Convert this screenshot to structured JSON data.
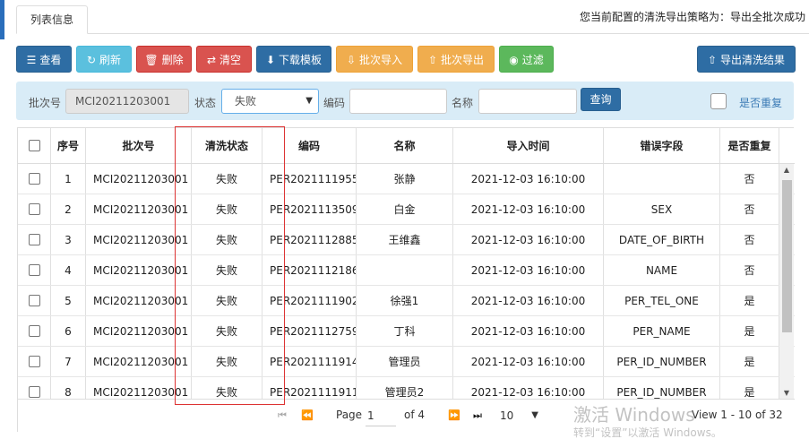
{
  "tab": {
    "label": "列表信息"
  },
  "policy": {
    "text": "您当前配置的清洗导出策略为：导出全批次成功"
  },
  "toolbar": {
    "buttons": [
      {
        "icon": "list-icon",
        "glyph": "☰",
        "label": "查看"
      },
      {
        "icon": "refresh-icon",
        "glyph": "↻",
        "label": "刷新"
      },
      {
        "icon": "trash-icon",
        "glyph": "🗑",
        "label": "删除"
      },
      {
        "icon": "swap-icon",
        "glyph": "⇄",
        "label": "清空"
      },
      {
        "icon": "download-icon",
        "glyph": "⬇",
        "label": "下载模板"
      },
      {
        "icon": "import-icon",
        "glyph": "⇩",
        "label": "批次导入"
      },
      {
        "icon": "export-icon",
        "glyph": "⇧",
        "label": "批次导出"
      },
      {
        "icon": "eye-icon",
        "glyph": "◉",
        "label": "过滤"
      },
      {
        "icon": "export-clean-icon",
        "glyph": "⇧",
        "label": "导出清洗结果"
      }
    ]
  },
  "filter": {
    "batch_label": "批次号",
    "batch_value": "MCI20211203001",
    "status_label": "状态",
    "status_value": "失败",
    "code_label": "编码",
    "code_value": "",
    "name_label": "名称",
    "name_value": "",
    "query_label": "查询",
    "duplicate_label": "是否重复"
  },
  "table": {
    "columns": [
      "序号",
      "批次号",
      "清洗状态",
      "编码",
      "名称",
      "导入时间",
      "错误字段",
      "是否重复"
    ],
    "rows": [
      [
        "1",
        "MCI20211203001",
        "失败",
        "PER2021111955",
        "张静",
        "2021-12-03 16:10:00",
        "",
        "否"
      ],
      [
        "2",
        "MCI20211203001",
        "失败",
        "PER2021113509",
        "白金",
        "2021-12-03 16:10:00",
        "SEX",
        "否"
      ],
      [
        "3",
        "MCI20211203001",
        "失败",
        "PER2021112885",
        "王维鑫",
        "2021-12-03 16:10:00",
        "DATE_OF_BIRTH",
        "否"
      ],
      [
        "4",
        "MCI20211203001",
        "失败",
        "PER2021112186",
        "",
        "2021-12-03 16:10:00",
        "NAME",
        "否"
      ],
      [
        "5",
        "MCI20211203001",
        "失败",
        "PER2021111902",
        "徐强1",
        "2021-12-03 16:10:00",
        "PER_TEL_ONE",
        "是"
      ],
      [
        "6",
        "MCI20211203001",
        "失败",
        "PER2021112759",
        "丁科",
        "2021-12-03 16:10:00",
        "PER_NAME",
        "是"
      ],
      [
        "7",
        "MCI20211203001",
        "失败",
        "PER2021111914",
        "管理员",
        "2021-12-03 16:10:00",
        "PER_ID_NUMBER",
        "是"
      ],
      [
        "8",
        "MCI20211203001",
        "失败",
        "PER2021111911",
        "管理员2",
        "2021-12-03 16:10:00",
        "PER_ID_NUMBER",
        "是"
      ]
    ]
  },
  "pager": {
    "page_label": "Page",
    "page_value": "1",
    "of_label": "of 4",
    "page_size": "10",
    "view_text": "View 1 - 10 of 32"
  },
  "watermark": {
    "line1": "激活 Windows",
    "line2": "转到“设置”以激活 Windows。"
  }
}
